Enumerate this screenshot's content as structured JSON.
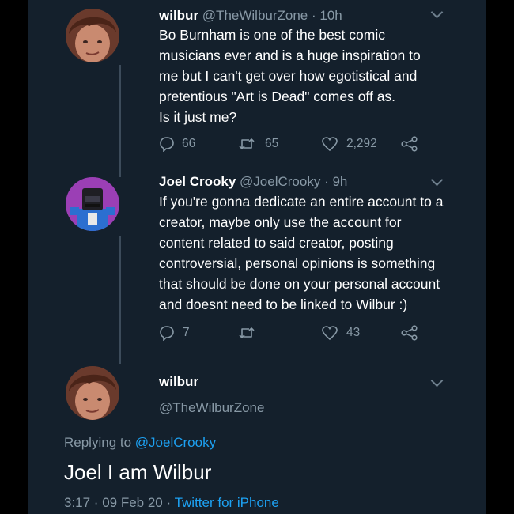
{
  "tweet1": {
    "name": "wilbur",
    "handle": "@TheWilburZone",
    "time": "· 10h",
    "lines": [
      "Bo Burnham is one of the best comic",
      "musicians ever and is a huge inspiration to",
      "me but I can't get over how egotistical and",
      "pretentious \"Art is Dead\" comes off as.",
      "Is it just me?"
    ],
    "replies": "66",
    "retweets": "65",
    "likes": "2,292"
  },
  "tweet2": {
    "name": "Joel Crooky",
    "handle": "@JoelCrooky",
    "time": "· 9h",
    "lines": [
      "If you're gonna dedicate an entire account to a",
      "creator, maybe only use the account for",
      "content related to said creator, posting",
      "controversial, personal opinions is something",
      "that should be done on your personal account",
      "and doesnt need to be linked to Wilbur :)"
    ],
    "replies": "7",
    "retweets": "",
    "likes": "43"
  },
  "tweet3": {
    "name": "wilbur",
    "handle": "@TheWilburZone",
    "replying_prefix": "Replying to",
    "replying_handle": "@JoelCrooky",
    "text": "Joel I am Wilbur",
    "meta_time": "3:17 · 09 Feb 20 ·",
    "meta_client": "Twitter for iPhone"
  },
  "colors": {
    "background": "#14202c",
    "text": "#ffffff",
    "muted": "#8899a6",
    "link": "#1da1f2",
    "thread_line": "#3c4b5a"
  },
  "icons": [
    "reply-icon",
    "retweet-icon",
    "like-icon",
    "share-icon",
    "chevron-down-icon"
  ]
}
